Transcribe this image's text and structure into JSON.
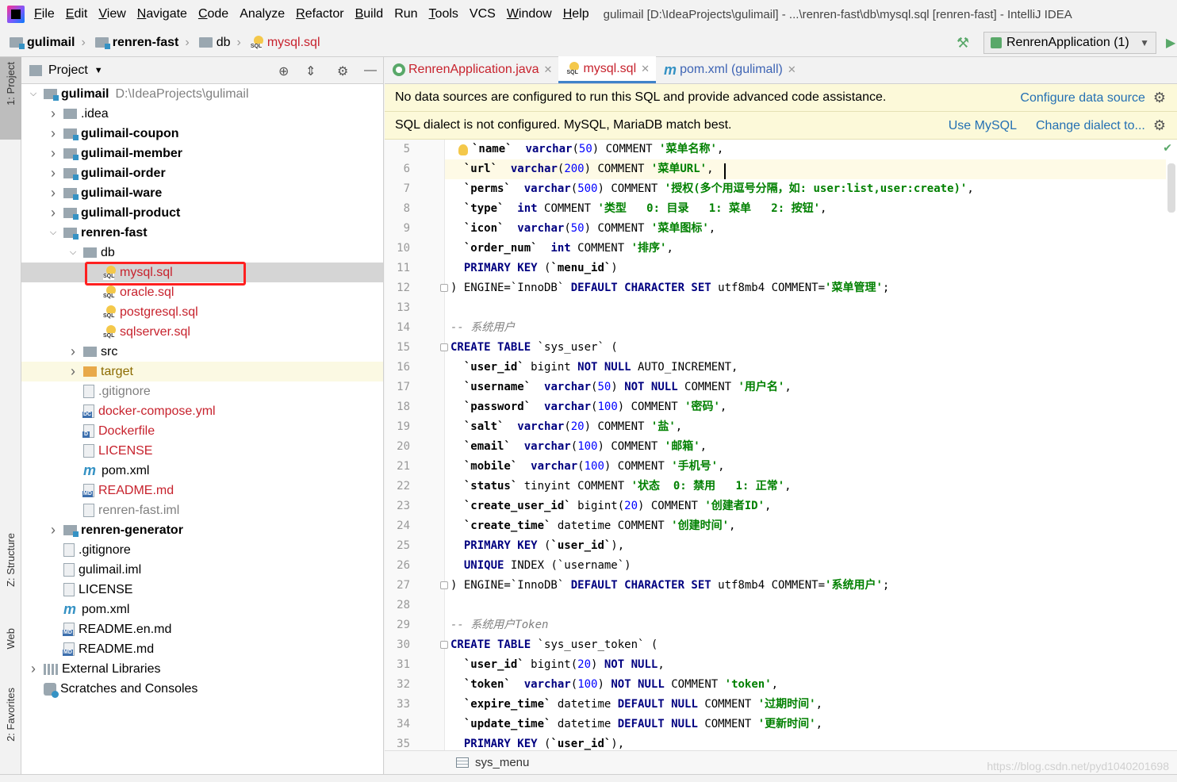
{
  "menubar": {
    "items": [
      {
        "label": "File",
        "u": "F",
        "rest": "ile"
      },
      {
        "label": "Edit",
        "u": "E",
        "rest": "dit"
      },
      {
        "label": "View",
        "u": "V",
        "rest": "iew"
      },
      {
        "label": "Navigate",
        "u": "N",
        "rest": "avigate"
      },
      {
        "label": "Code",
        "u": "C",
        "rest": "ode"
      },
      {
        "label": "Analyze",
        "u": "",
        "rest": "Analyze"
      },
      {
        "label": "Refactor",
        "u": "R",
        "rest": "efactor"
      },
      {
        "label": "Build",
        "u": "B",
        "rest": "uild"
      },
      {
        "label": "Run",
        "u": "",
        "rest": "Run"
      },
      {
        "label": "Tools",
        "u": "T",
        "rest": "ools"
      },
      {
        "label": "VCS",
        "u": "",
        "rest": "VCS"
      },
      {
        "label": "Window",
        "u": "W",
        "rest": "indow"
      },
      {
        "label": "Help",
        "u": "H",
        "rest": "elp"
      }
    ],
    "window_title": "gulimail [D:\\IdeaProjects\\gulimail] - ...\\renren-fast\\db\\mysql.sql [renren-fast] - IntelliJ IDEA"
  },
  "navbar": {
    "crumbs": [
      "gulimail",
      "renren-fast",
      "db",
      "mysql.sql"
    ],
    "run_config": "RenrenApplication (1)"
  },
  "left_stripe": {
    "project": "1: Project",
    "structure": "Z: Structure",
    "web": "Web",
    "favorites": "2: Favorites"
  },
  "project_panel": {
    "title": "Project",
    "tree": [
      {
        "label": "gulimail",
        "hint": "D:\\IdeaProjects\\gulimail",
        "depth": 0,
        "arrow": "down",
        "icon": "folder-mod",
        "style": "bold"
      },
      {
        "label": ".idea",
        "depth": 1,
        "arrow": "right",
        "icon": "folder",
        "style": ""
      },
      {
        "label": "gulimail-coupon",
        "depth": 1,
        "arrow": "right",
        "icon": "folder-mod",
        "style": "bold"
      },
      {
        "label": "gulimail-member",
        "depth": 1,
        "arrow": "right",
        "icon": "folder-mod",
        "style": "bold"
      },
      {
        "label": "gulimail-order",
        "depth": 1,
        "arrow": "right",
        "icon": "folder-mod",
        "style": "bold"
      },
      {
        "label": "gulimail-ware",
        "depth": 1,
        "arrow": "right",
        "icon": "folder-mod",
        "style": "bold"
      },
      {
        "label": "gulimall-product",
        "depth": 1,
        "arrow": "right",
        "icon": "folder-mod",
        "style": "bold"
      },
      {
        "label": "renren-fast",
        "depth": 1,
        "arrow": "down",
        "icon": "folder-mod",
        "style": "bold"
      },
      {
        "label": "db",
        "depth": 2,
        "arrow": "down",
        "icon": "folder",
        "style": ""
      },
      {
        "label": "mysql.sql",
        "depth": 3,
        "arrow": "",
        "icon": "sql",
        "style": "red",
        "selected": true
      },
      {
        "label": "oracle.sql",
        "depth": 3,
        "arrow": "",
        "icon": "sql",
        "style": "red"
      },
      {
        "label": "postgresql.sql",
        "depth": 3,
        "arrow": "",
        "icon": "sql",
        "style": "red"
      },
      {
        "label": "sqlserver.sql",
        "depth": 3,
        "arrow": "",
        "icon": "sql",
        "style": "red"
      },
      {
        "label": "src",
        "depth": 2,
        "arrow": "right",
        "icon": "folder",
        "style": ""
      },
      {
        "label": "target",
        "depth": 2,
        "arrow": "right",
        "icon": "folder-orange",
        "style": "olive",
        "excluded": true
      },
      {
        "label": ".gitignore",
        "depth": 2,
        "arrow": "",
        "icon": "file",
        "style": "gray"
      },
      {
        "label": "docker-compose.yml",
        "depth": 2,
        "arrow": "",
        "icon": "file-dc",
        "style": "red"
      },
      {
        "label": "Dockerfile",
        "depth": 2,
        "arrow": "",
        "icon": "file-d",
        "style": "red"
      },
      {
        "label": "LICENSE",
        "depth": 2,
        "arrow": "",
        "icon": "file",
        "style": "red"
      },
      {
        "label": "pom.xml",
        "depth": 2,
        "arrow": "",
        "icon": "maven",
        "style": ""
      },
      {
        "label": "README.md",
        "depth": 2,
        "arrow": "",
        "icon": "file-md",
        "style": "red"
      },
      {
        "label": "renren-fast.iml",
        "depth": 2,
        "arrow": "",
        "icon": "file",
        "style": "gray"
      },
      {
        "label": "renren-generator",
        "depth": 1,
        "arrow": "right",
        "icon": "folder-mod",
        "style": "bold"
      },
      {
        "label": ".gitignore",
        "depth": 1,
        "arrow": "",
        "icon": "file",
        "style": ""
      },
      {
        "label": "gulimail.iml",
        "depth": 1,
        "arrow": "",
        "icon": "file",
        "style": ""
      },
      {
        "label": "LICENSE",
        "depth": 1,
        "arrow": "",
        "icon": "file",
        "style": ""
      },
      {
        "label": "pom.xml",
        "depth": 1,
        "arrow": "",
        "icon": "maven",
        "style": ""
      },
      {
        "label": "README.en.md",
        "depth": 1,
        "arrow": "",
        "icon": "file-md",
        "style": ""
      },
      {
        "label": "README.md",
        "depth": 1,
        "arrow": "",
        "icon": "file-md",
        "style": ""
      },
      {
        "label": "External Libraries",
        "depth": 0,
        "arrow": "right",
        "icon": "lib",
        "style": ""
      },
      {
        "label": "Scratches and Consoles",
        "depth": 0,
        "arrow": "",
        "icon": "scratch",
        "style": ""
      }
    ]
  },
  "editor": {
    "tabs": [
      {
        "label": "RenrenApplication.java",
        "kind": "java"
      },
      {
        "label": "mysql.sql",
        "kind": "sql",
        "active": true
      },
      {
        "label": "pom.xml (gulimall)",
        "kind": "pom"
      }
    ],
    "banner1": {
      "text": "No data sources are configured to run this SQL and provide advanced code assistance.",
      "action": "Configure data source"
    },
    "banner2": {
      "text": "SQL dialect is not configured. MySQL, MariaDB match best.",
      "action1": "Use MySQL",
      "action2": "Change dialect to..."
    },
    "first_line": 5,
    "lines": [
      [
        [
          "col",
          "`name`"
        ],
        [
          "",
          ""
        ],
        [
          "",
          "  "
        ],
        [
          "kw",
          "varchar"
        ],
        [
          "",
          "("
        ],
        [
          "num",
          "50"
        ],
        [
          "",
          ") COMMENT "
        ],
        [
          "str",
          "'菜单名称'"
        ],
        [
          "",
          ","
        ]
      ],
      [
        [
          "",
          "  "
        ],
        [
          "col",
          "`url`"
        ],
        [
          "",
          "  "
        ],
        [
          "kw",
          "varchar"
        ],
        [
          "",
          "("
        ],
        [
          "num",
          "200"
        ],
        [
          "",
          ") COMMENT "
        ],
        [
          "str",
          "'菜单URL'"
        ],
        [
          "",
          ","
        ]
      ],
      [
        [
          "",
          "  "
        ],
        [
          "col",
          "`perms`"
        ],
        [
          "",
          "  "
        ],
        [
          "kw",
          "varchar"
        ],
        [
          "",
          "("
        ],
        [
          "num",
          "500"
        ],
        [
          "",
          ") COMMENT "
        ],
        [
          "str",
          "'授权(多个用逗号分隔，如: user:list,user:create)'"
        ],
        [
          "",
          ","
        ]
      ],
      [
        [
          "",
          "  "
        ],
        [
          "col",
          "`type`"
        ],
        [
          "",
          "  "
        ],
        [
          "kw",
          "int"
        ],
        [
          "",
          ""
        ],
        [
          "",
          ""
        ],
        [
          "",
          " COMMENT "
        ],
        [
          "str",
          "'类型   0: 目录   1: 菜单   2: 按钮'"
        ],
        [
          "",
          ","
        ]
      ],
      [
        [
          "",
          "  "
        ],
        [
          "col",
          "`icon`"
        ],
        [
          "",
          "  "
        ],
        [
          "kw",
          "varchar"
        ],
        [
          "",
          "("
        ],
        [
          "num",
          "50"
        ],
        [
          "",
          ") COMMENT "
        ],
        [
          "str",
          "'菜单图标'"
        ],
        [
          "",
          ","
        ]
      ],
      [
        [
          "",
          "  "
        ],
        [
          "col",
          "`order_num`"
        ],
        [
          "",
          "  "
        ],
        [
          "kw",
          "int"
        ],
        [
          "",
          ""
        ],
        [
          "",
          ""
        ],
        [
          "",
          " COMMENT "
        ],
        [
          "str",
          "'排序'"
        ],
        [
          "",
          ","
        ]
      ],
      [
        [
          "",
          "  "
        ],
        [
          "kw",
          "PRIMARY KEY"
        ],
        [
          "",
          " ("
        ],
        [
          "col",
          "`menu_id`"
        ],
        [
          "",
          ")"
        ]
      ],
      [
        [
          "",
          ") ENGINE=`InnoDB` "
        ],
        [
          "kw",
          "DEFAULT CHARACTER SET"
        ],
        [
          "",
          " utf8mb4 COMMENT="
        ],
        [
          "str",
          "'菜单管理'"
        ],
        [
          "",
          ";"
        ]
      ],
      [],
      [
        [
          "cmt",
          "-- 系统用户"
        ]
      ],
      [
        [
          "kw",
          "CREATE TABLE"
        ],
        [
          "",
          " `sys_user` ("
        ]
      ],
      [
        [
          "",
          "  "
        ],
        [
          "col",
          "`user_id`"
        ],
        [
          "",
          " bigint "
        ],
        [
          "kw",
          "NOT NULL"
        ],
        [
          "",
          " AUTO_INCREMENT,"
        ]
      ],
      [
        [
          "",
          "  "
        ],
        [
          "col",
          "`username`"
        ],
        [
          "",
          "  "
        ],
        [
          "kw",
          "varchar"
        ],
        [
          "",
          "("
        ],
        [
          "num",
          "50"
        ],
        [
          ") ",
          ") "
        ],
        [
          "kw",
          "NOT NULL"
        ],
        [
          "",
          " COMMENT "
        ],
        [
          "str",
          "'用户名'"
        ],
        [
          "",
          ","
        ]
      ],
      [
        [
          "",
          "  "
        ],
        [
          "col",
          "`password`"
        ],
        [
          "",
          "  "
        ],
        [
          "kw",
          "varchar"
        ],
        [
          "",
          "("
        ],
        [
          "num",
          "100"
        ],
        [
          "",
          ") COMMENT "
        ],
        [
          "str",
          "'密码'"
        ],
        [
          "",
          ","
        ]
      ],
      [
        [
          "",
          "  "
        ],
        [
          "col",
          "`salt`"
        ],
        [
          "",
          "  "
        ],
        [
          "kw",
          "varchar"
        ],
        [
          "",
          "("
        ],
        [
          "num",
          "20"
        ],
        [
          "",
          ") COMMENT "
        ],
        [
          "str",
          "'盐'"
        ],
        [
          "",
          ","
        ]
      ],
      [
        [
          "",
          "  "
        ],
        [
          "col",
          "`email`"
        ],
        [
          "",
          "  "
        ],
        [
          "kw",
          "varchar"
        ],
        [
          "",
          "("
        ],
        [
          "num",
          "100"
        ],
        [
          "",
          ") COMMENT "
        ],
        [
          "str",
          "'邮箱'"
        ],
        [
          "",
          ","
        ]
      ],
      [
        [
          "",
          "  "
        ],
        [
          "col",
          "`mobile`"
        ],
        [
          "",
          "  "
        ],
        [
          "kw",
          "varchar"
        ],
        [
          "",
          "("
        ],
        [
          "num",
          "100"
        ],
        [
          "",
          ") COMMENT "
        ],
        [
          "str",
          "'手机号'"
        ],
        [
          "",
          ","
        ]
      ],
      [
        [
          "",
          "  "
        ],
        [
          "col",
          "`status`"
        ],
        [
          "",
          " tinyint COMMENT "
        ],
        [
          "str",
          "'状态  0: 禁用   1: 正常'"
        ],
        [
          "",
          ","
        ]
      ],
      [
        [
          "",
          "  "
        ],
        [
          "col",
          "`create_user_id`"
        ],
        [
          "",
          " bigint("
        ],
        [
          "num",
          "20"
        ],
        [
          "",
          ") COMMENT "
        ],
        [
          "str",
          "'创建者ID'"
        ],
        [
          "",
          ","
        ]
      ],
      [
        [
          "",
          "  "
        ],
        [
          "col",
          "`create_time`"
        ],
        [
          "",
          " datetime COMMENT "
        ],
        [
          "str",
          "'创建时间'"
        ],
        [
          "",
          ","
        ]
      ],
      [
        [
          "",
          "  "
        ],
        [
          "kw",
          "PRIMARY KEY"
        ],
        [
          "",
          " ("
        ],
        [
          "col",
          "`user_id`"
        ],
        [
          "",
          "),"
        ]
      ],
      [
        [
          "",
          "  "
        ],
        [
          "kw",
          "UNIQUE"
        ],
        [
          "",
          " INDEX (`username`)"
        ]
      ],
      [
        [
          "",
          ") ENGINE=`InnoDB` "
        ],
        [
          "kw",
          "DEFAULT CHARACTER SET"
        ],
        [
          "",
          " utf8mb4 COMMENT="
        ],
        [
          "str",
          "'系统用户'"
        ],
        [
          "",
          ";"
        ]
      ],
      [],
      [
        [
          "cmt",
          "-- 系统用户Token"
        ]
      ],
      [
        [
          "kw",
          "CREATE TABLE"
        ],
        [
          "",
          " `sys_user_token` ("
        ]
      ],
      [
        [
          "",
          "  "
        ],
        [
          "col",
          "`user_id`"
        ],
        [
          "",
          " bigint("
        ],
        [
          "num",
          "20"
        ],
        [
          "",
          ") "
        ],
        [
          "kw",
          "NOT NULL"
        ],
        [
          "",
          ","
        ]
      ],
      [
        [
          "",
          "  "
        ],
        [
          "col",
          "`token`"
        ],
        [
          "",
          "  "
        ],
        [
          "kw",
          "varchar"
        ],
        [
          "",
          "("
        ],
        [
          "num",
          "100"
        ],
        [
          "",
          ") "
        ],
        [
          "kw",
          "NOT NULL"
        ],
        [
          "",
          " COMMENT "
        ],
        [
          "str",
          "'token'"
        ],
        [
          "",
          ","
        ]
      ],
      [
        [
          "",
          "  "
        ],
        [
          "col",
          "`expire_time`"
        ],
        [
          "",
          " datetime "
        ],
        [
          "kw",
          "DEFAULT NULL"
        ],
        [
          "",
          " COMMENT "
        ],
        [
          "str",
          "'过期时间'"
        ],
        [
          "",
          ","
        ]
      ],
      [
        [
          "",
          "  "
        ],
        [
          "col",
          "`update_time`"
        ],
        [
          "",
          " datetime "
        ],
        [
          "kw",
          "DEFAULT NULL"
        ],
        [
          "",
          " COMMENT "
        ],
        [
          "str",
          "'更新时间'"
        ],
        [
          "",
          ","
        ]
      ],
      [
        [
          "",
          "  "
        ],
        [
          "kw",
          "PRIMARY KEY"
        ],
        [
          "",
          " ("
        ],
        [
          "col",
          "`user_id`"
        ],
        [
          "",
          "),"
        ]
      ]
    ],
    "breadcrumb": "sys_menu"
  },
  "watermark": "https://blog.csdn.net/pyd1040201698",
  "colors": {
    "accent": "#4083c9",
    "selection_box": "#ff2020",
    "banner_bg": "#fcf9d9"
  }
}
